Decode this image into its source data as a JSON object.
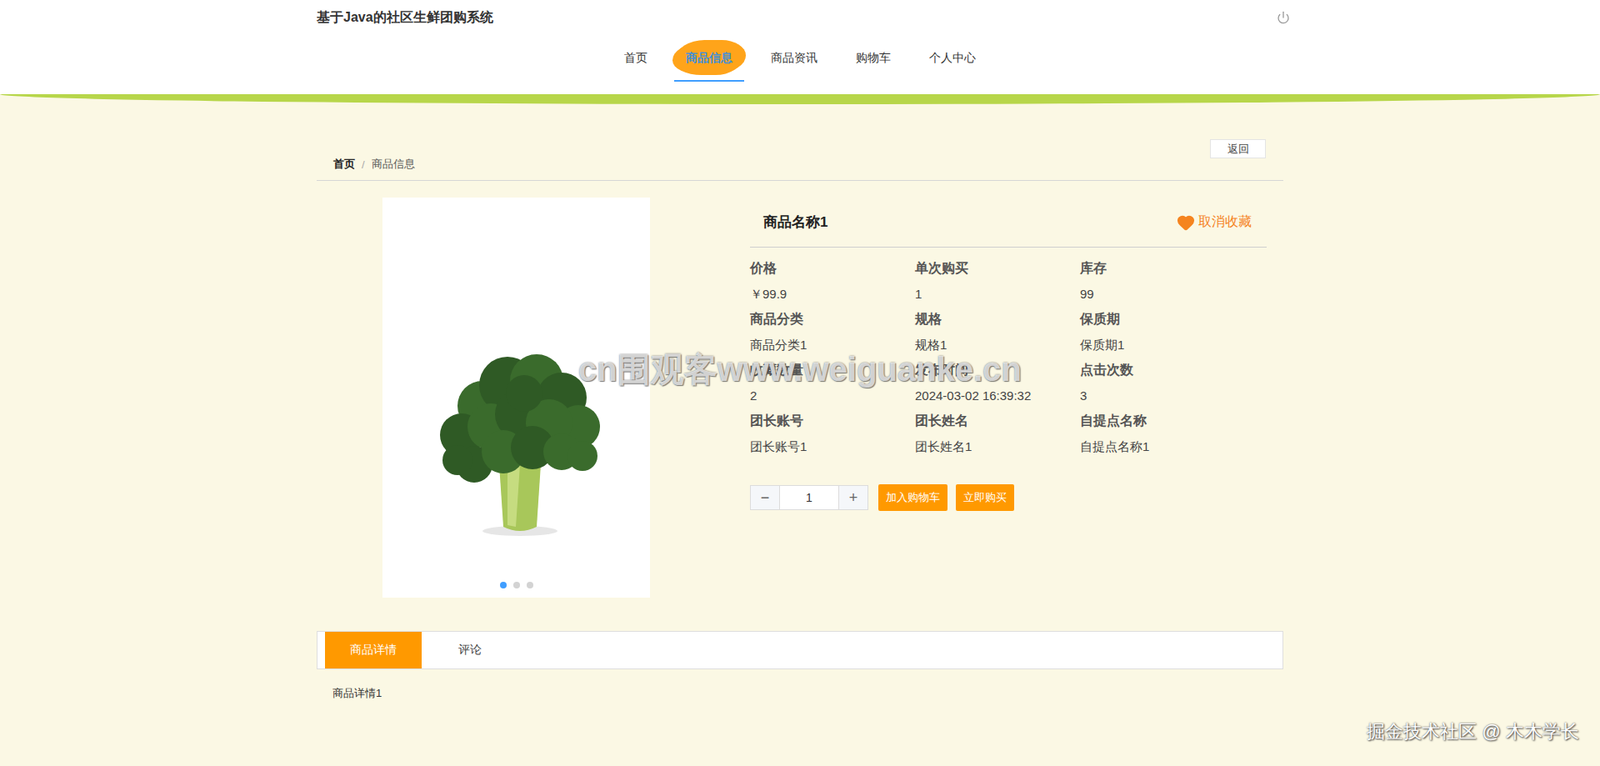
{
  "header": {
    "title": "基于Java的社区生鲜团购系统"
  },
  "nav": [
    {
      "label": "首页",
      "selected": false
    },
    {
      "label": "商品信息",
      "selected": true
    },
    {
      "label": "商品资讯",
      "selected": false
    },
    {
      "label": "购物车",
      "selected": false
    },
    {
      "label": "个人中心",
      "selected": false
    }
  ],
  "back_button": "返回",
  "breadcrumb": {
    "items": [
      "首页",
      "商品信息"
    ],
    "separator": "/"
  },
  "carousel": {
    "dots": [
      {
        "selected": true
      },
      {
        "selected": false
      },
      {
        "selected": false
      }
    ]
  },
  "product": {
    "name": "商品名称1",
    "favorite": {
      "label": "取消收藏",
      "favorited": true
    },
    "fields": [
      {
        "label": "价格",
        "value": "￥99.9"
      },
      {
        "label": "单次购买",
        "value": "1"
      },
      {
        "label": "库存",
        "value": "99"
      },
      {
        "label": "商品分类",
        "value": "商品分类1"
      },
      {
        "label": "规格",
        "value": "规格1"
      },
      {
        "label": "保质期",
        "value": "保质期1"
      },
      {
        "label": "收藏数量",
        "value": "2"
      },
      {
        "label": "发布时间",
        "value": "2024-03-02 16:39:32"
      },
      {
        "label": "点击次数",
        "value": "3"
      },
      {
        "label": "团长账号",
        "value": "团长账号1"
      },
      {
        "label": "团长姓名",
        "value": "团长姓名1"
      },
      {
        "label": "自提点名称",
        "value": "自提点名称1"
      }
    ]
  },
  "quantity": {
    "minus": "−",
    "value": "1",
    "plus": "+"
  },
  "actions": [
    "加入购物车",
    "立即购买"
  ],
  "detail_tabs": [
    {
      "label": "商品详情",
      "selected": true
    },
    {
      "label": "评论",
      "selected": false
    }
  ],
  "detail_text": "商品详情1",
  "watermarks": {
    "center": "cn围观客www.weiguanke.cn",
    "corner": "掘金技术社区 @ 木木学长"
  }
}
